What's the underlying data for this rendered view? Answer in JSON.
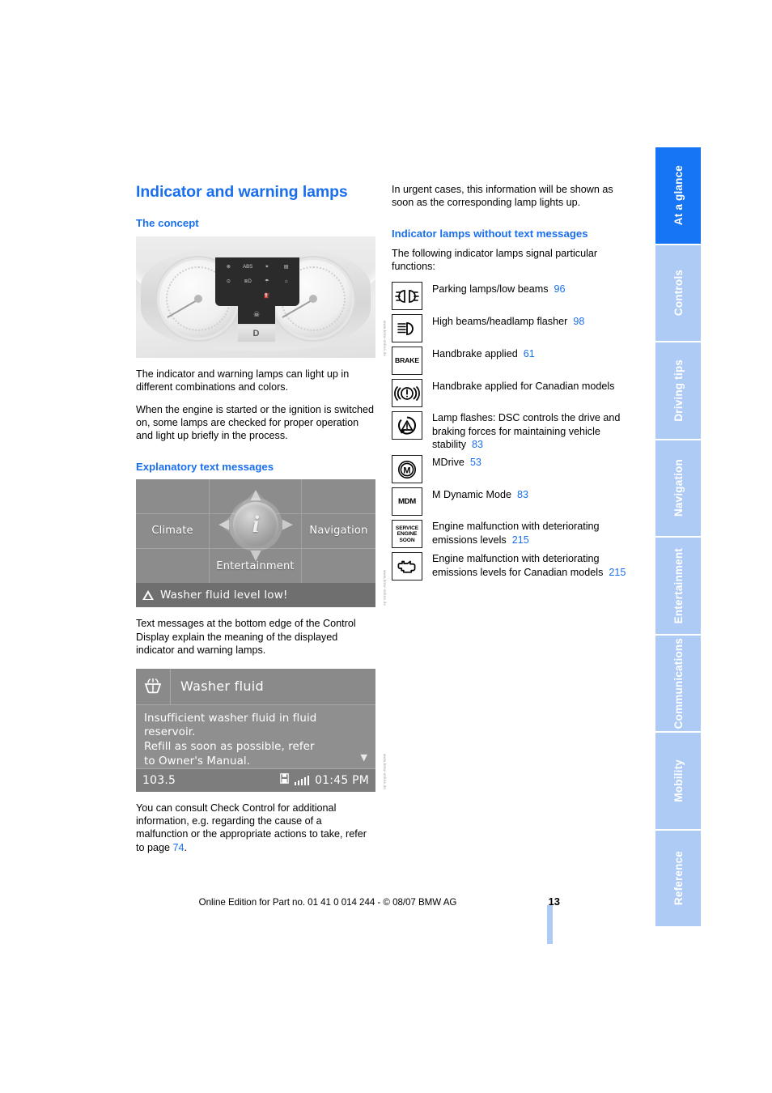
{
  "document": {
    "page_number": "13",
    "footer": "Online Edition for Part no. 01 41 0 014 244 - © 08/07 BMW AG",
    "accent_color": "#1a6fee",
    "tab_active_color": "#1675f5",
    "tab_inactive_color": "#aecbf5"
  },
  "tabs": [
    {
      "label": "At a glance",
      "active": true
    },
    {
      "label": "Controls",
      "active": false
    },
    {
      "label": "Driving tips",
      "active": false
    },
    {
      "label": "Navigation",
      "active": false
    },
    {
      "label": "Entertainment",
      "active": false
    },
    {
      "label": "Communications",
      "active": false
    },
    {
      "label": "Mobility",
      "active": false
    },
    {
      "label": "Reference",
      "active": false
    }
  ],
  "left_column": {
    "title": "Indicator and warning lamps",
    "concept_heading": "The concept",
    "cluster_figure": {
      "caption_code": "www.bmw-online.de",
      "center_display_glyph": "☠",
      "gear_indicator": "D",
      "lamp_glyphs": [
        "⊗",
        "ABS",
        "✶",
        "▤",
        "⊙",
        "≣D",
        "☂",
        "⌂",
        "",
        "",
        "⛽",
        ""
      ]
    },
    "concept_paragraphs": [
      "The indicator and warning lamps can light up in different combinations and colors.",
      "When the engine is started or the ignition is switched on, some lamps are checked for proper operation and light up briefly in the process."
    ],
    "explanatory_heading": "Explanatory text messages",
    "idrive_figure": {
      "caption_code": "www.bmw-online.de",
      "menu_climate": "Climate",
      "menu_navigation": "Navigation",
      "menu_entertainment": "Entertainment",
      "center_icon": "i",
      "status_message": "Washer fluid level low!"
    },
    "explanatory_paragraph": "Text messages at the bottom edge of the Control Display explain the meaning of the displayed indicator and warning lamps.",
    "checkcontrol_figure": {
      "caption_code": "www.bmw-online.de",
      "title": "Washer fluid",
      "body_line_1": "Insufficient washer fluid in fluid",
      "body_line_2": "reservoir.",
      "body_line_3": "Refill as soon as possible, refer",
      "body_line_4": "to Owner's Manual.",
      "scroll_indicator": "▼",
      "status_frequency": "103.5",
      "status_time": "01:45 PM"
    },
    "checkcontrol_paragraph_prefix": "You can consult Check Control for additional information, e.g. regarding the cause of a malfunction or the appropriate actions to take, refer to page ",
    "checkcontrol_page_ref": "74",
    "checkcontrol_paragraph_suffix": "."
  },
  "right_column": {
    "intro_paragraph": "In urgent cases, this information will be shown as soon as the corresponding lamp lights up.",
    "lamps_heading": "Indicator lamps without text messages",
    "lamps_intro": "The following indicator lamps signal particular functions:",
    "lamps": [
      {
        "icon": "parking-lamps-low-beams-icon",
        "icon_text": "",
        "text": "Parking lamps/low beams",
        "page": "96"
      },
      {
        "icon": "high-beams-headlamp-flasher-icon",
        "icon_text": "",
        "text": "High beams/headlamp flasher",
        "page": "98"
      },
      {
        "icon": "brake-text-icon",
        "icon_text": "BRAKE",
        "text": "Handbrake applied",
        "page": "61"
      },
      {
        "icon": "handbrake-canadian-icon",
        "icon_text": "",
        "text": "Handbrake applied for Canadian models",
        "page": ""
      },
      {
        "icon": "dsc-triangle-icon",
        "icon_text": "",
        "text": "Lamp flashes: DSC controls the drive and braking forces for maintaining vehicle stability",
        "page": "83"
      },
      {
        "icon": "mdrive-icon",
        "icon_text": "M",
        "text": "MDrive",
        "page": "53"
      },
      {
        "icon": "mdm-icon",
        "icon_text": "MDM",
        "text": "M Dynamic Mode",
        "page": "83"
      },
      {
        "icon": "service-engine-soon-icon",
        "icon_text": "SERVICE ENGINE SOON",
        "text": "Engine malfunction with deteriorating emissions levels",
        "page": "215"
      },
      {
        "icon": "check-engine-icon",
        "icon_text": "",
        "text": "Engine malfunction with deteriorating emissions levels for Canadian models",
        "page": "215"
      }
    ]
  }
}
